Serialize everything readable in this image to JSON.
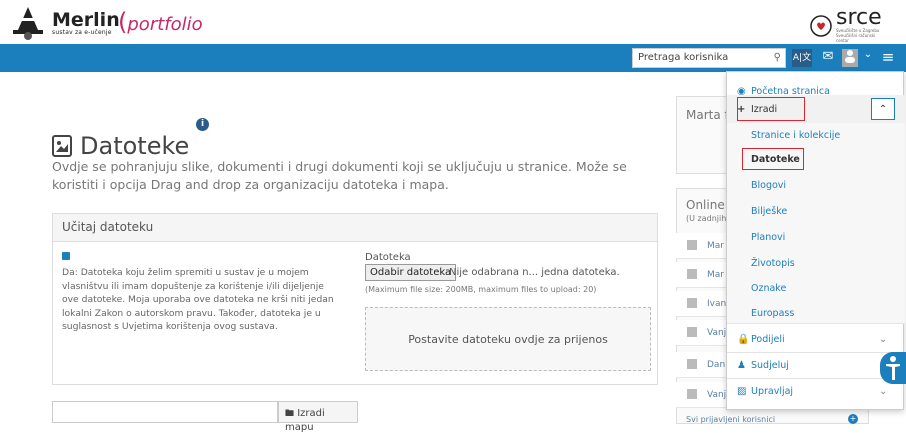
{
  "header": {
    "merlin": "Merlin",
    "merlin_sub": "sustav za e-učenje",
    "portfolio": "portfolio",
    "srce": "srce",
    "srce_sub": "Sveučilište u Zagrebu Sveučilišni računski centar"
  },
  "navbar": {
    "search_placeholder": "Pretraga korisnika",
    "icons": [
      "search-icon",
      "language-icon",
      "mail-icon",
      "user-icon",
      "chevron-down-icon",
      "menu-icon"
    ]
  },
  "page": {
    "title": "Datoteke",
    "description": "Ovdje se pohranjuju slike, dokumenti i drugi dokumenti koji se uključuju u stranice. Može se koristiti i opcija Drag and drop za organizaciju datoteka i mapa.",
    "upload_title": "Učitaj datoteku",
    "agree_text": "Da: Datoteka koju želim spremiti u sustav je u mojem vlasništvu ili imam dopuštenje za korištenje i/ili dijeljenje ove datoteke. Moja uporaba ove datoteka ne krši niti jedan lokalni Zakon o autorskom pravu. Također, datoteka je u suglasnost s Uvjetima korištenja ovog sustava.",
    "file_label": "Datoteka",
    "file_button": "Odabir datoteka",
    "file_status": "Nije odabrana n... jedna datoteka.",
    "max_size": "(Maximum file size: 200MB, maximum files to upload: 20)",
    "drop_text": "Postavite datoteku ovdje za prijenos",
    "mkdir_button": "Izradi mapu"
  },
  "right": {
    "profile_name": "Marta f",
    "online_title": "Online",
    "online_sub": "(U zadnjih",
    "users": [
      "Mar",
      "Mar",
      "Ivan",
      "Vanj",
      "Dan",
      "Vanj"
    ],
    "all_users": "Svi prijavljeni korisnici"
  },
  "menu": {
    "home": "Početna stranica",
    "create": "Izradi",
    "create_items": [
      "Stranice i kolekcije",
      "Datoteke",
      "Blogovi",
      "Bilješke",
      "Planovi",
      "Životopis",
      "Oznake",
      "Europass"
    ],
    "share": "Podijeli",
    "engage": "Sudjeluj",
    "manage": "Upravljaj"
  }
}
